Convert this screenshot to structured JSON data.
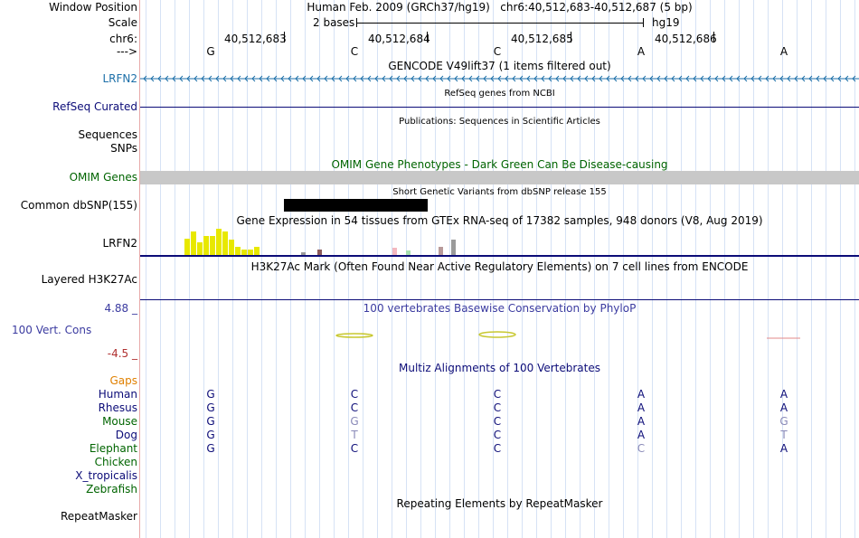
{
  "header": {
    "window_position_label": "Window Position",
    "window_position_text": "Human Feb. 2009 (GRCh37/hg19)   chr6:40,512,683-40,512,687 (5 bp)",
    "scale_label": "Scale",
    "scale_text": "2 bases",
    "scale_assembly": "hg19",
    "chrom_label": "chr6:",
    "strand_label": "--->",
    "coordinates": [
      "40,512,683",
      "40,512,684",
      "40,512,685",
      "40,512,686"
    ],
    "bases": [
      "G",
      "C",
      "C",
      "A",
      "A"
    ]
  },
  "tracks": {
    "gencode": {
      "title": "GENCODE V49lift37 (1 items filtered out)",
      "label": "LRFN2"
    },
    "refseq": {
      "title": "RefSeq genes from NCBI",
      "label": "RefSeq Curated"
    },
    "publications": {
      "title": "Publications: Sequences in Scientific Articles",
      "label1": "Sequences",
      "label2": "SNPs"
    },
    "omim": {
      "title": "OMIM Gene Phenotypes - Dark Green Can Be Disease-causing",
      "label": "OMIM Genes"
    },
    "dbsnp": {
      "title": "Short Genetic Variants from dbSNP release 155",
      "label": "Common dbSNP(155)"
    },
    "gtex": {
      "title": "Gene Expression in 54 tissues from GTEx RNA-seq of 17382 samples, 948 donors (V8, Aug 2019)",
      "label": "LRFN2"
    },
    "h3k27ac": {
      "title": "H3K27Ac Mark (Often Found Near Active Regulatory Elements) on 7 cell lines from ENCODE",
      "label": "Layered H3K27Ac"
    },
    "phylop": {
      "title": "100 vertebrates Basewise Conservation by PhyloP",
      "label": "100 Vert. Cons",
      "max": "4.88 _",
      "min": "-4.5 _"
    },
    "multiz": {
      "title": "Multiz Alignments of 100 Vertebrates",
      "gaps_label": "Gaps",
      "species": [
        {
          "name": "Human",
          "bases": [
            "G",
            "C",
            "C",
            "A",
            "A"
          ]
        },
        {
          "name": "Rhesus",
          "bases": [
            "G",
            "C",
            "C",
            "A",
            "A"
          ]
        },
        {
          "name": "Mouse",
          "bases": [
            "G",
            "G",
            "C",
            "A",
            "G"
          ]
        },
        {
          "name": "Dog",
          "bases": [
            "G",
            "T",
            "C",
            "A",
            "T"
          ]
        },
        {
          "name": "Elephant",
          "bases": [
            "G",
            "C",
            "C",
            "C",
            "A"
          ]
        },
        {
          "name": "Chicken",
          "bases": []
        },
        {
          "name": "X_tropicalis",
          "bases": []
        },
        {
          "name": "Zebrafish",
          "bases": []
        }
      ]
    },
    "repeatmasker": {
      "title": "Repeating Elements by RepeatMasker",
      "label": "RepeatMasker"
    }
  },
  "gtex_expression": {
    "yellow_levels": [
      0.6,
      0.85,
      0.45,
      0.7,
      0.7,
      0.95,
      0.85,
      0.55,
      0.3,
      0.2,
      0.2,
      0.3
    ],
    "other_levels": [
      {
        "color": "#999999",
        "level": 0.1
      },
      {
        "color": "#8b5a5a",
        "level": 0.2
      },
      {
        "color": "#f4b8c0",
        "level": 0.25
      },
      {
        "color": "#a8e0b0",
        "level": 0.15
      },
      {
        "color": "#b89a9a",
        "level": 0.3
      },
      {
        "color": "#9a9a9a",
        "level": 0.55
      }
    ]
  },
  "colors": {
    "gencode_blue": "#1c6fa8",
    "refseq_navy": "#0c0c78",
    "omim_green": "#006400",
    "phylop_blue": "#3b3ba0",
    "phylop_neg": "#b03030",
    "gaps_orange": "#e08000",
    "gtex_yellow": "#e8e800"
  }
}
